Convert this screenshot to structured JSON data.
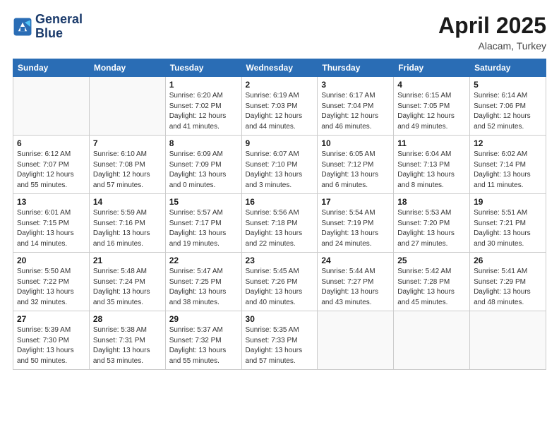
{
  "logo": {
    "line1": "General",
    "line2": "Blue"
  },
  "title": {
    "month_year": "April 2025",
    "location": "Alacam, Turkey"
  },
  "weekdays": [
    "Sunday",
    "Monday",
    "Tuesday",
    "Wednesday",
    "Thursday",
    "Friday",
    "Saturday"
  ],
  "weeks": [
    [
      {
        "day": "",
        "info": ""
      },
      {
        "day": "",
        "info": ""
      },
      {
        "day": "1",
        "info": "Sunrise: 6:20 AM\nSunset: 7:02 PM\nDaylight: 12 hours and 41 minutes."
      },
      {
        "day": "2",
        "info": "Sunrise: 6:19 AM\nSunset: 7:03 PM\nDaylight: 12 hours and 44 minutes."
      },
      {
        "day": "3",
        "info": "Sunrise: 6:17 AM\nSunset: 7:04 PM\nDaylight: 12 hours and 46 minutes."
      },
      {
        "day": "4",
        "info": "Sunrise: 6:15 AM\nSunset: 7:05 PM\nDaylight: 12 hours and 49 minutes."
      },
      {
        "day": "5",
        "info": "Sunrise: 6:14 AM\nSunset: 7:06 PM\nDaylight: 12 hours and 52 minutes."
      }
    ],
    [
      {
        "day": "6",
        "info": "Sunrise: 6:12 AM\nSunset: 7:07 PM\nDaylight: 12 hours and 55 minutes."
      },
      {
        "day": "7",
        "info": "Sunrise: 6:10 AM\nSunset: 7:08 PM\nDaylight: 12 hours and 57 minutes."
      },
      {
        "day": "8",
        "info": "Sunrise: 6:09 AM\nSunset: 7:09 PM\nDaylight: 13 hours and 0 minutes."
      },
      {
        "day": "9",
        "info": "Sunrise: 6:07 AM\nSunset: 7:10 PM\nDaylight: 13 hours and 3 minutes."
      },
      {
        "day": "10",
        "info": "Sunrise: 6:05 AM\nSunset: 7:12 PM\nDaylight: 13 hours and 6 minutes."
      },
      {
        "day": "11",
        "info": "Sunrise: 6:04 AM\nSunset: 7:13 PM\nDaylight: 13 hours and 8 minutes."
      },
      {
        "day": "12",
        "info": "Sunrise: 6:02 AM\nSunset: 7:14 PM\nDaylight: 13 hours and 11 minutes."
      }
    ],
    [
      {
        "day": "13",
        "info": "Sunrise: 6:01 AM\nSunset: 7:15 PM\nDaylight: 13 hours and 14 minutes."
      },
      {
        "day": "14",
        "info": "Sunrise: 5:59 AM\nSunset: 7:16 PM\nDaylight: 13 hours and 16 minutes."
      },
      {
        "day": "15",
        "info": "Sunrise: 5:57 AM\nSunset: 7:17 PM\nDaylight: 13 hours and 19 minutes."
      },
      {
        "day": "16",
        "info": "Sunrise: 5:56 AM\nSunset: 7:18 PM\nDaylight: 13 hours and 22 minutes."
      },
      {
        "day": "17",
        "info": "Sunrise: 5:54 AM\nSunset: 7:19 PM\nDaylight: 13 hours and 24 minutes."
      },
      {
        "day": "18",
        "info": "Sunrise: 5:53 AM\nSunset: 7:20 PM\nDaylight: 13 hours and 27 minutes."
      },
      {
        "day": "19",
        "info": "Sunrise: 5:51 AM\nSunset: 7:21 PM\nDaylight: 13 hours and 30 minutes."
      }
    ],
    [
      {
        "day": "20",
        "info": "Sunrise: 5:50 AM\nSunset: 7:22 PM\nDaylight: 13 hours and 32 minutes."
      },
      {
        "day": "21",
        "info": "Sunrise: 5:48 AM\nSunset: 7:24 PM\nDaylight: 13 hours and 35 minutes."
      },
      {
        "day": "22",
        "info": "Sunrise: 5:47 AM\nSunset: 7:25 PM\nDaylight: 13 hours and 38 minutes."
      },
      {
        "day": "23",
        "info": "Sunrise: 5:45 AM\nSunset: 7:26 PM\nDaylight: 13 hours and 40 minutes."
      },
      {
        "day": "24",
        "info": "Sunrise: 5:44 AM\nSunset: 7:27 PM\nDaylight: 13 hours and 43 minutes."
      },
      {
        "day": "25",
        "info": "Sunrise: 5:42 AM\nSunset: 7:28 PM\nDaylight: 13 hours and 45 minutes."
      },
      {
        "day": "26",
        "info": "Sunrise: 5:41 AM\nSunset: 7:29 PM\nDaylight: 13 hours and 48 minutes."
      }
    ],
    [
      {
        "day": "27",
        "info": "Sunrise: 5:39 AM\nSunset: 7:30 PM\nDaylight: 13 hours and 50 minutes."
      },
      {
        "day": "28",
        "info": "Sunrise: 5:38 AM\nSunset: 7:31 PM\nDaylight: 13 hours and 53 minutes."
      },
      {
        "day": "29",
        "info": "Sunrise: 5:37 AM\nSunset: 7:32 PM\nDaylight: 13 hours and 55 minutes."
      },
      {
        "day": "30",
        "info": "Sunrise: 5:35 AM\nSunset: 7:33 PM\nDaylight: 13 hours and 57 minutes."
      },
      {
        "day": "",
        "info": ""
      },
      {
        "day": "",
        "info": ""
      },
      {
        "day": "",
        "info": ""
      }
    ]
  ]
}
